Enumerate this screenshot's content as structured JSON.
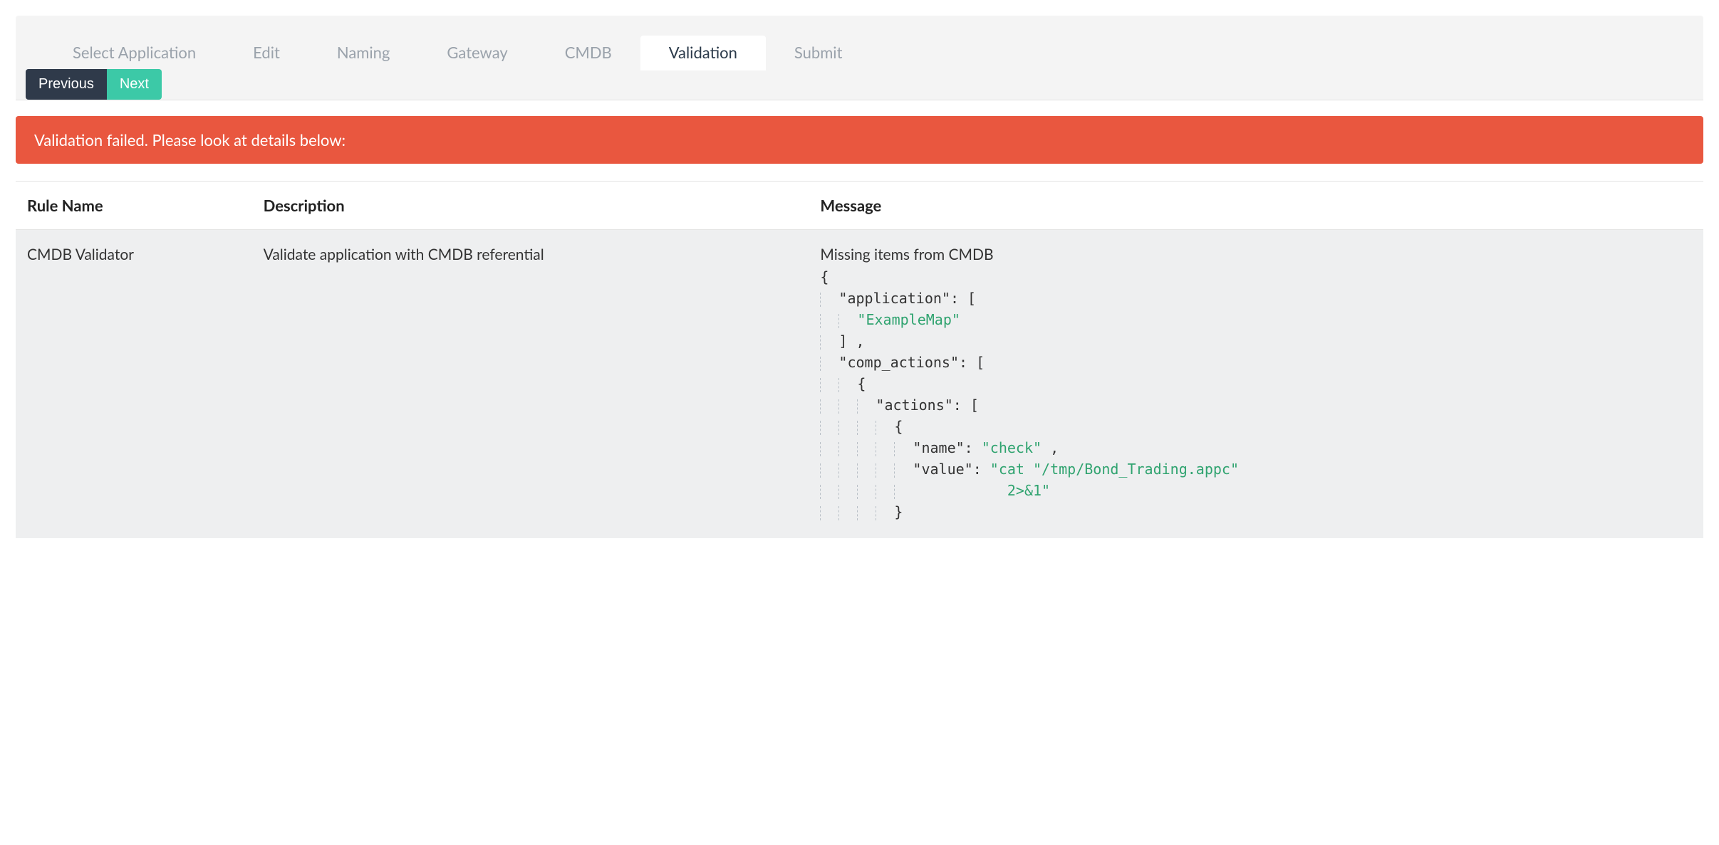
{
  "tabs": [
    {
      "label": "Select Application",
      "active": false
    },
    {
      "label": "Edit",
      "active": false
    },
    {
      "label": "Naming",
      "active": false
    },
    {
      "label": "Gateway",
      "active": false
    },
    {
      "label": "CMDB",
      "active": false
    },
    {
      "label": "Validation",
      "active": true
    },
    {
      "label": "Submit",
      "active": false
    }
  ],
  "nav": {
    "previous": "Previous",
    "next": "Next"
  },
  "alert": "Validation failed. Please look at details below:",
  "table": {
    "headers": {
      "rule": "Rule Name",
      "description": "Description",
      "message": "Message"
    },
    "rows": [
      {
        "rule": "CMDB Validator",
        "description": "Validate application with CMDB referential",
        "message_title": "Missing items from CMDB",
        "message_json": {
          "application": [
            "ExampleMap"
          ],
          "comp_actions": [
            {
              "actions": [
                {
                  "name": "check",
                  "value": "cat \"/tmp/Bond_Trading.appc\" 2>&1"
                }
              ]
            }
          ]
        },
        "message_lines": [
          {
            "text": "{",
            "indent": 0
          },
          {
            "text": "\"application\": [",
            "indent": 1
          },
          {
            "text": "\"ExampleMap\"",
            "indent": 2,
            "string": true
          },
          {
            "text": "] ,",
            "indent": 1
          },
          {
            "text": "\"comp_actions\": [",
            "indent": 1
          },
          {
            "text": "{",
            "indent": 2
          },
          {
            "text": "\"actions\": [",
            "indent": 3
          },
          {
            "text": "{",
            "indent": 4
          },
          {
            "kv": true,
            "key": "\"name\": ",
            "val": "\"check\"",
            "tail": " ,",
            "indent": 5
          },
          {
            "kv": true,
            "key": "\"value\": ",
            "val": "\"cat \"/tmp/Bond_Trading.appc\"",
            "indent": 5
          },
          {
            "cont": true,
            "val": "2>&1\"",
            "indent": 5
          },
          {
            "text": "}",
            "indent": 4
          }
        ]
      }
    ]
  }
}
